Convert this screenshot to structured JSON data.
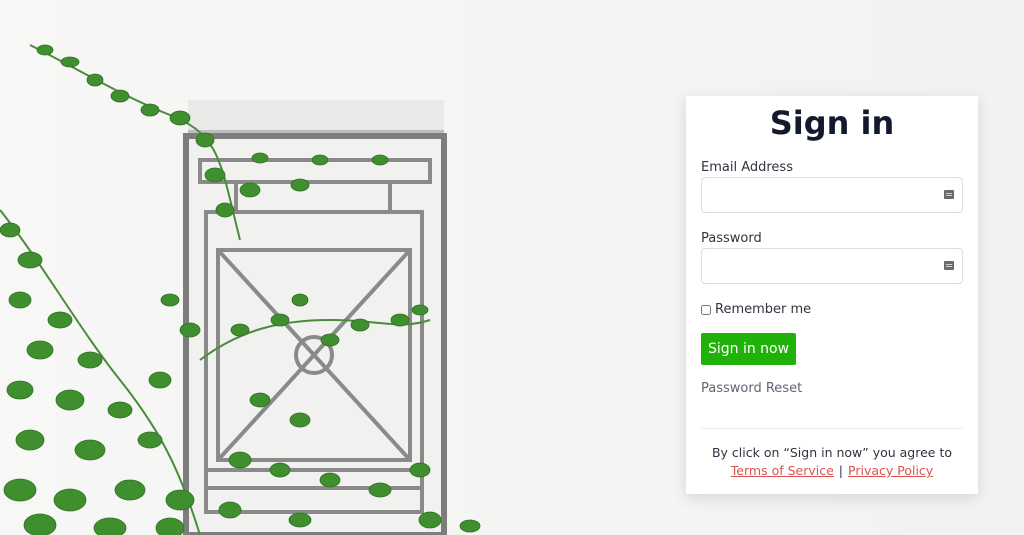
{
  "page": {
    "title": "Sign in"
  },
  "form": {
    "email_label": "Email Address",
    "email_value": "",
    "password_label": "Password",
    "password_value": "",
    "remember_label": "Remember me",
    "remember_checked": false,
    "submit_label": "Sign in now",
    "reset_link": "Password Reset"
  },
  "footer": {
    "agreement_text": "By click on “Sign in now” you agree to",
    "terms_link": "Terms of Service",
    "separator": "|",
    "privacy_link": "Privacy Policy"
  },
  "colors": {
    "button": "#21b20a",
    "links": "#d9534f",
    "title": "#141a2e"
  },
  "icons": {
    "email_field": "autofill-card-icon",
    "password_field": "autofill-card-icon"
  }
}
